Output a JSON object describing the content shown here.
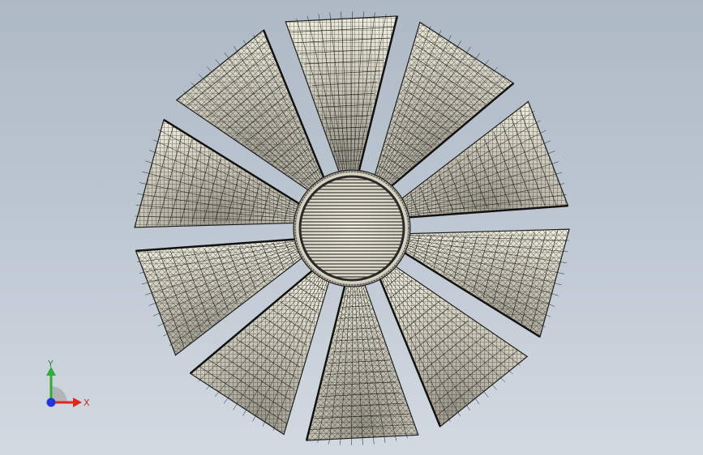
{
  "viewport": {
    "model": "fan-mesh",
    "blade_count": 10,
    "colors": {
      "background_top": "#aeb9c6",
      "background_bottom": "#d2d9e1",
      "blade_fill": "#e4e1d0",
      "blade_mesh": "#1e1e1e",
      "hub_fill": "#ebe8d8"
    }
  },
  "triad": {
    "x_label": "X",
    "y_label": "Y",
    "colors": {
      "x_axis": "#e0281f",
      "y_axis": "#2fae3a",
      "z_axis": "#2036d8"
    }
  }
}
